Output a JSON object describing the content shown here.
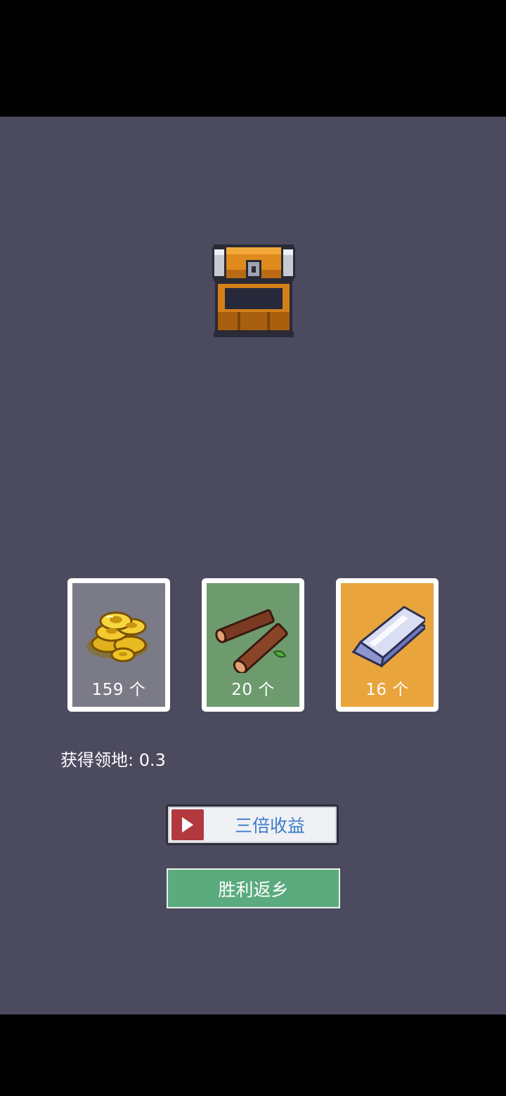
{
  "rewards": [
    {
      "icon": "gold-coins-icon",
      "count": "159 个",
      "card_color": "#7b7a87"
    },
    {
      "icon": "wood-logs-icon",
      "count": "20 个",
      "card_color": "#6d9b6e"
    },
    {
      "icon": "iron-ingot-icon",
      "count": "16 个",
      "card_color": "#e9a43c"
    }
  ],
  "territory": {
    "label": "获得领地: 0.3"
  },
  "buttons": {
    "triple_label": "三倍收益",
    "victory_label": "胜利返乡"
  },
  "colors": {
    "background": "#4b4a5e",
    "victory_button": "#5bab7f",
    "ad_badge": "#b23a3e",
    "triple_text": "#3d7ccc"
  }
}
